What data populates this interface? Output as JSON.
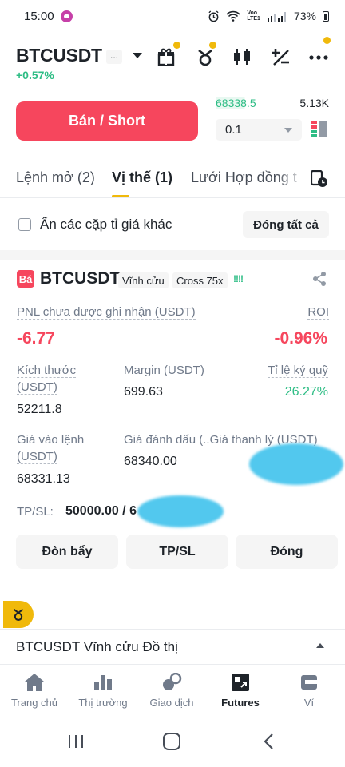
{
  "status_bar": {
    "time": "15:00",
    "net_label_top": "Voo",
    "net_label_bottom": "LTE1",
    "battery": "73%"
  },
  "header": {
    "symbol": "BTCUSDT",
    "more": "...",
    "change": "+0.57%",
    "icons": [
      "gift-icon",
      "bot-icon",
      "candlestick-icon",
      "calculator-icon",
      "more-icon"
    ]
  },
  "trade": {
    "sell_button": "Bán / Short",
    "price": "68338.5",
    "amount": "5.13K",
    "qty_value": "0.1"
  },
  "tabs": {
    "open_orders": "Lệnh mở (2)",
    "positions": "Vị thế (1)",
    "grid": "Lưới Hợp đồng t"
  },
  "filter": {
    "hide_other_pairs": "Ẩn các cặp tỉ giá khác",
    "close_all": "Đóng tất cả"
  },
  "position": {
    "badge": "Bá",
    "symbol": "BTCUSDT",
    "type": "Vĩnh cửu",
    "margin_mode": "Cross 75x",
    "bars": "!!!!",
    "pnl_label": "PNL chưa được ghi nhận (USDT)",
    "pnl_value": "-6.77",
    "roi_label": "ROI",
    "roi_value": "-0.96%",
    "size_label_1": "Kích thước",
    "size_label_2": "(USDT)",
    "size_value": "52211.8",
    "margin_label": "Margin (USDT)",
    "margin_value": "699.63",
    "margin_ratio_label": "Tỉ lệ ký quỹ",
    "margin_ratio_value": "26.27%",
    "entry_label_1": "Giá vào lệnh",
    "entry_label_2": "(USDT)",
    "entry_value": "68331.13",
    "mark_label": "Giá đánh dấu (..Giá thanh lý (USDT)",
    "mark_value": "68340.00",
    "tpsl_label": "TP/SL:",
    "tpsl_value": "50000.00 / 6"
  },
  "actions": {
    "leverage": "Đòn bẩy",
    "tpsl": "TP/SL",
    "close": "Đóng"
  },
  "chart_bar": {
    "title": "BTCUSDT Vĩnh cửu Đồ thị"
  },
  "bottom_nav": [
    {
      "label": "Trang chủ",
      "icon": "home-icon"
    },
    {
      "label": "Thị trường",
      "icon": "markets-icon"
    },
    {
      "label": "Giao dịch",
      "icon": "trade-icon"
    },
    {
      "label": "Futures",
      "icon": "futures-icon"
    },
    {
      "label": "Ví",
      "icon": "wallet-icon"
    }
  ],
  "colors": {
    "accent": "#f0b90b",
    "sell": "#f6465d",
    "buy": "#2ebd85"
  }
}
